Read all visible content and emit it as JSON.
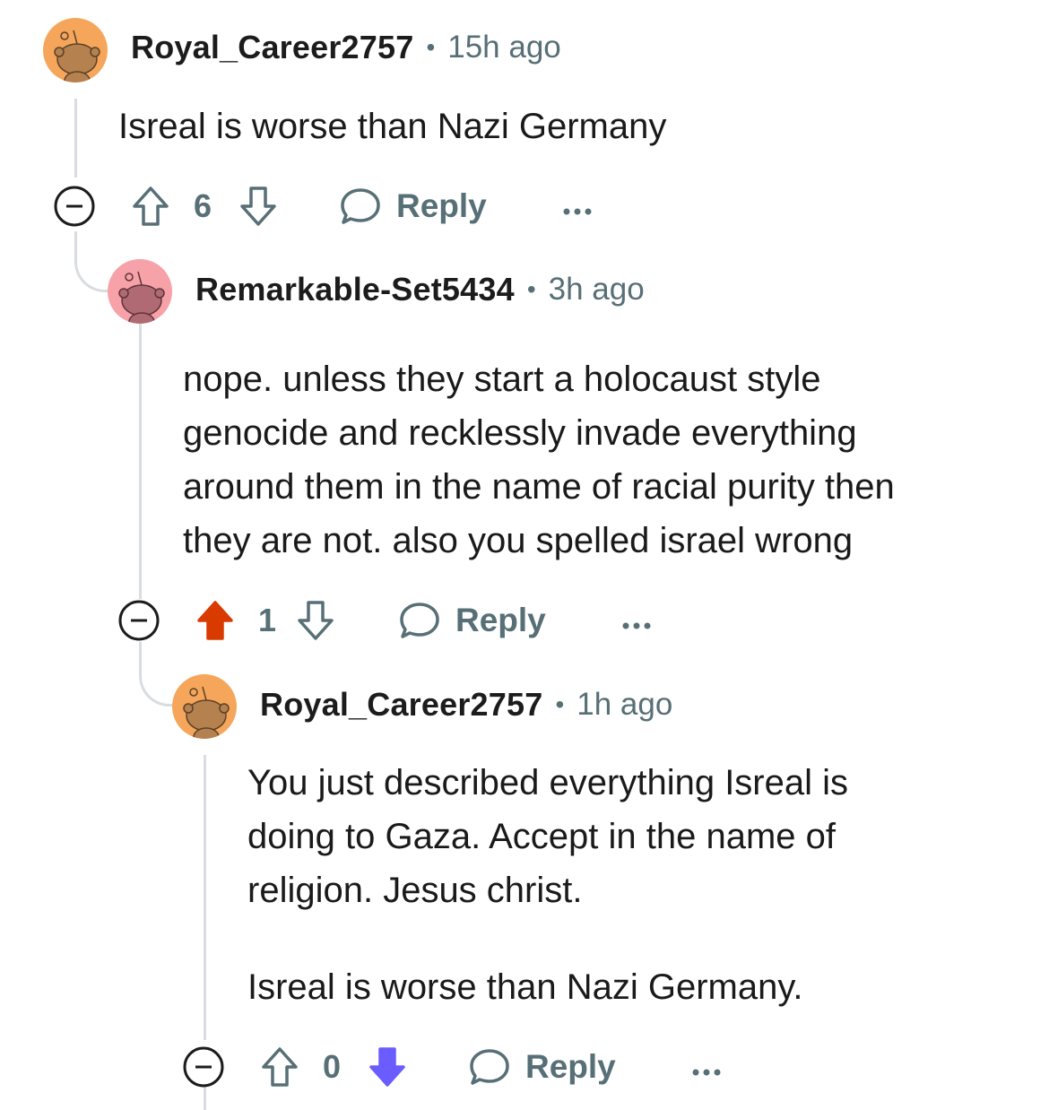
{
  "comments": [
    {
      "username": "Royal_Career2757",
      "separator": "•",
      "time": "15h ago",
      "avatar_color": "#f5a65b",
      "body": [
        "Isreal is worse than Nazi Germany"
      ],
      "vote_count": "6",
      "vote_state": "none",
      "reply_label": "Reply",
      "more_label": "•••"
    },
    {
      "username": "Remarkable-Set5434",
      "separator": "•",
      "time": "3h ago",
      "avatar_color": "#f7a1a8",
      "body": [
        "nope. unless they start a holocaust style genocide and recklessly invade everything around them in the name of racial purity then they are not. also you spelled israel wrong"
      ],
      "vote_count": "1",
      "vote_state": "upvoted",
      "reply_label": "Reply",
      "more_label": "•••"
    },
    {
      "username": "Royal_Career2757",
      "separator": "•",
      "time": "1h ago",
      "avatar_color": "#f5a65b",
      "body": [
        "You just described everything Isreal is doing to Gaza. Accept in the name of religion. Jesus christ.",
        "Isreal is worse than Nazi Germany."
      ],
      "vote_count": "0",
      "vote_state": "downvoted",
      "reply_label": "Reply",
      "more_label": "•••"
    }
  ],
  "colors": {
    "upvote_active": "#d93a00",
    "downvote_active": "#6a5cff",
    "icon_gray": "#576f76",
    "thread_line": "#d9dde0"
  }
}
